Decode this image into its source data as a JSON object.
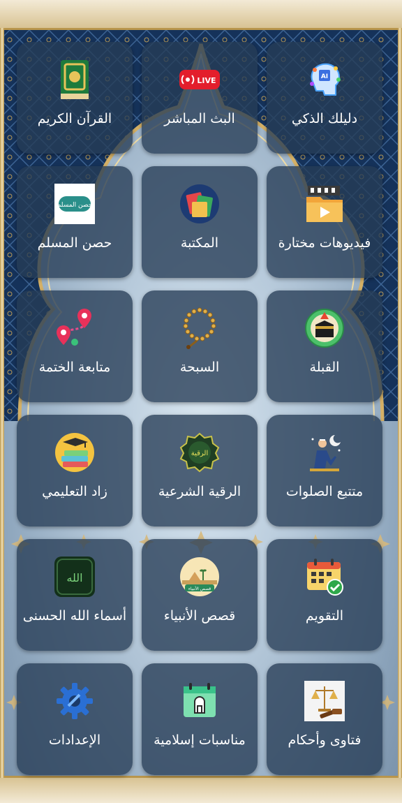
{
  "tiles": [
    {
      "label": "القرآن الكريم",
      "icon": "quran-book-icon"
    },
    {
      "label": "البث المباشر",
      "icon": "live-broadcast-icon",
      "badge": "LIVE"
    },
    {
      "label": "دليلك الذكي",
      "icon": "ai-head-icon",
      "badge": "AI"
    },
    {
      "label": "حصن المسلم",
      "icon": "hisn-almuslim-icon",
      "badge": "حصن المسلم"
    },
    {
      "label": "المكتبة",
      "icon": "library-books-icon"
    },
    {
      "label": "فيديوهات مختارة",
      "icon": "video-folder-icon"
    },
    {
      "label": "متابعة الختمة",
      "icon": "route-pins-icon"
    },
    {
      "label": "السبحة",
      "icon": "prayer-beads-icon"
    },
    {
      "label": "القبلة",
      "icon": "kaaba-compass-icon"
    },
    {
      "label": "زاد التعليمي",
      "icon": "graduation-books-icon"
    },
    {
      "label": "الرقية الشرعية",
      "icon": "ruqyah-badge-icon",
      "badge": "الرقية"
    },
    {
      "label": "متتبع الصلوات",
      "icon": "praying-man-icon"
    },
    {
      "label": "أسماء الله الحسنى",
      "icon": "allah-names-icon",
      "badge": "الله"
    },
    {
      "label": "قصص الأنبياء",
      "icon": "prophets-stories-icon",
      "badge": "قصص الأنبياء"
    },
    {
      "label": "التقويم",
      "icon": "calendar-check-icon"
    },
    {
      "label": "الإعدادات",
      "icon": "settings-gear-icon"
    },
    {
      "label": "مناسبات إسلامية",
      "icon": "islamic-events-icon"
    },
    {
      "label": "فتاوى وأحكام",
      "icon": "scales-gavel-icon"
    }
  ],
  "colors": {
    "tile": "#263c56",
    "frame_gold": "#b8954c",
    "arch_blue": "#1c3a63"
  }
}
